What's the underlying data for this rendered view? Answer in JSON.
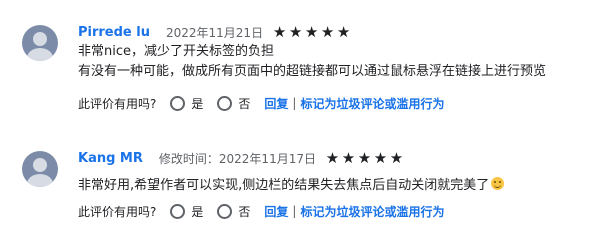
{
  "reviews": [
    {
      "author": "Pirrede lu",
      "date": "2022年11月21日",
      "rating": 5,
      "lines": [
        "非常nice，减少了开关标签的负担",
        "有没有一种可能，做成所有页面中的超链接都可以通过鼠标悬浮在链接上进行预览"
      ],
      "helpful_question": "此评价有用吗?",
      "yes_label": "是",
      "no_label": "否",
      "reply_label": "回复",
      "separator": "|",
      "report_label": "标记为垃圾评论或滥用行为"
    },
    {
      "author": "Kang MR",
      "date": "修改时间：2022年11月17日",
      "rating": 5,
      "lines": [
        "非常好用,希望作者可以实现,侧边栏的结果失去焦点后自动关闭就完美了"
      ],
      "emoji_icon": "smiling-face-emoji",
      "helpful_question": "此评价有用吗?",
      "yes_label": "是",
      "no_label": "否",
      "reply_label": "回复",
      "separator": "|",
      "report_label": "标记为垃圾评论或滥用行为"
    }
  ],
  "star_glyph": "★",
  "colors": {
    "author": "#1a73e8",
    "link": "#1a73e8",
    "avatar_bg": "#7b8ba8",
    "avatar_fg": "#d7dce4",
    "text": "#202124",
    "muted": "#5f6368"
  }
}
